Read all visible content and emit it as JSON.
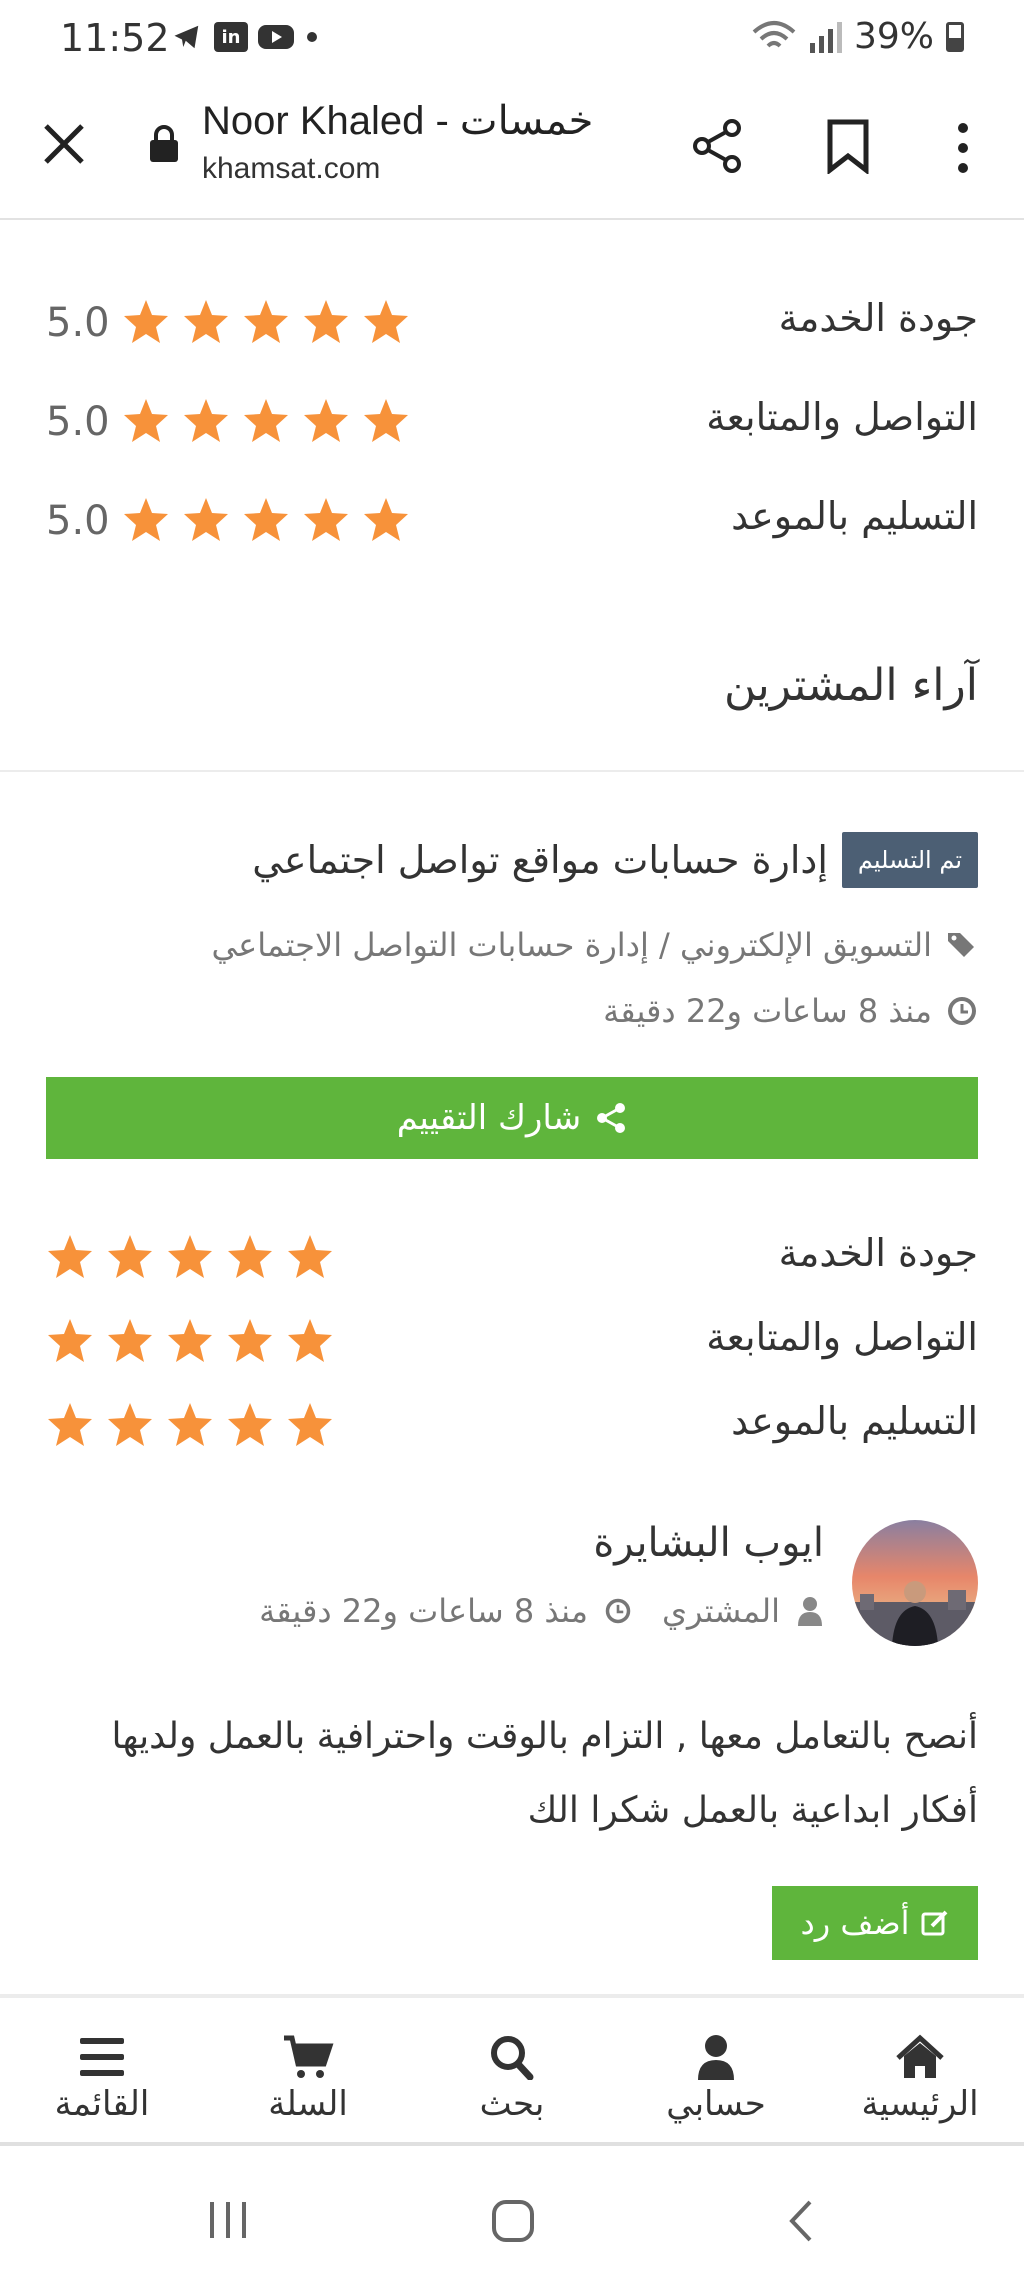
{
  "status_bar": {
    "time": "11:52",
    "battery": "39%",
    "icons": [
      "telegram-icon",
      "linkedin-icon",
      "youtube-icon",
      "dot-icon"
    ]
  },
  "browser": {
    "title": "Noor Khaled - خمسات",
    "url": "khamsat.com"
  },
  "summary_ratings": [
    {
      "label": "جودة الخدمة",
      "score": "5.0",
      "stars": 5
    },
    {
      "label": "التواصل والمتابعة",
      "score": "5.0",
      "stars": 5
    },
    {
      "label": "التسليم بالموعد",
      "score": "5.0",
      "stars": 5
    }
  ],
  "reviews_section": {
    "title": "آراء المشترين"
  },
  "review": {
    "status_badge": "تم التسليم",
    "service_name": "إدارة حسابات مواقع تواصل اجتماعي",
    "category": "التسويق الإلكتروني / إدارة حسابات التواصل الاجتماعي",
    "time_ago": "منذ 8 ساعات و22 دقيقة",
    "share_label": "شارك التقييم",
    "ratings": [
      {
        "label": "جودة الخدمة",
        "stars": 5
      },
      {
        "label": "التواصل والمتابعة",
        "stars": 5
      },
      {
        "label": "التسليم بالموعد",
        "stars": 5
      }
    ],
    "reviewer_name": "ايوب البشايرة",
    "reviewer_role": "المشتري",
    "reviewer_time": "منذ 8 ساعات و22 دقيقة",
    "text_line1": "أنصح بالتعامل معها , التزام بالوقت واحترافية بالعمل ولديها",
    "text_line2": "أفكار ابداعية بالعمل شكرا الك",
    "reply_label": "أضف رد"
  },
  "bottom_nav": {
    "home": "الرئيسية",
    "account": "حسابي",
    "search": "بحث",
    "cart": "السلة",
    "menu": "القائمة"
  },
  "colors": {
    "star": "#f7923a",
    "green": "#5fb53c",
    "badge": "#4c5f74"
  }
}
